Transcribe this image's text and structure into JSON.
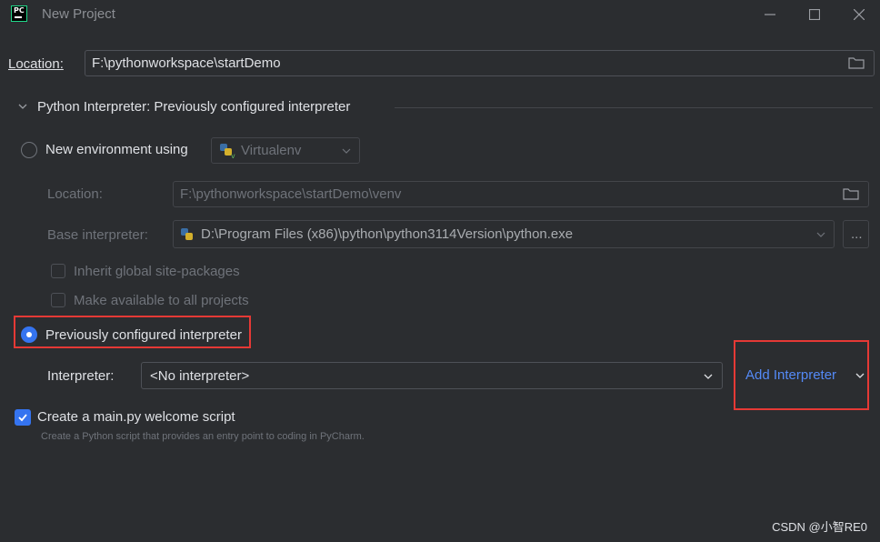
{
  "window": {
    "title": "New Project"
  },
  "location": {
    "label": "Location:",
    "value": "F:\\pythonworkspace\\startDemo"
  },
  "interpreter_section": {
    "header": "Python Interpreter: Previously configured interpreter",
    "new_env": {
      "label": "New environment using",
      "tool_value": "Virtualenv",
      "location_label": "Location:",
      "location_value": "F:\\pythonworkspace\\startDemo\\venv",
      "base_label": "Base interpreter:",
      "base_value": "D:\\Program Files (x86)\\python\\python3114Version\\python.exe",
      "browse_label": "...",
      "inherit_label": "Inherit global site-packages",
      "available_label": "Make available to all projects"
    },
    "previous": {
      "label": "Previously configured interpreter",
      "interpreter_label": "Interpreter:",
      "interpreter_value": "<No interpreter>",
      "add_label": "Add Interpreter"
    }
  },
  "welcome": {
    "label": "Create a main.py welcome script",
    "description": "Create a Python script that provides an entry point to coding in PyCharm."
  },
  "watermark": "CSDN @小智RE0",
  "colors": {
    "background": "#2b2d30",
    "accent": "#3574f0",
    "link": "#548af7",
    "highlight_box": "#e53935"
  }
}
